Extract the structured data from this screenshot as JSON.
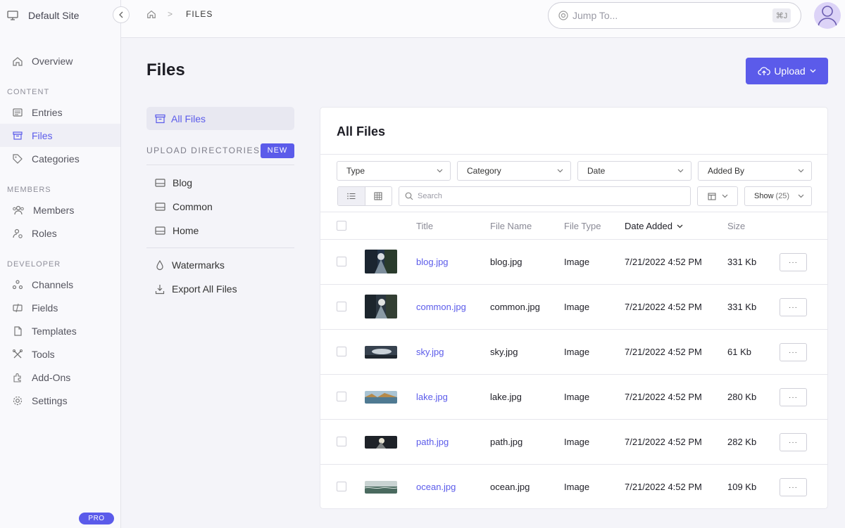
{
  "site": {
    "name": "Default Site"
  },
  "sidebar": {
    "overview": "Overview",
    "content_label": "CONTENT",
    "content": [
      {
        "label": "Entries",
        "icon": "entries-icon"
      },
      {
        "label": "Files",
        "icon": "files-icon",
        "active": true
      },
      {
        "label": "Categories",
        "icon": "tag-icon"
      }
    ],
    "members_label": "MEMBERS",
    "members": [
      {
        "label": "Members",
        "icon": "members-icon"
      },
      {
        "label": "Roles",
        "icon": "roles-icon"
      }
    ],
    "developer_label": "DEVELOPER",
    "developer": [
      {
        "label": "Channels",
        "icon": "channels-icon"
      },
      {
        "label": "Fields",
        "icon": "fields-icon"
      },
      {
        "label": "Templates",
        "icon": "templates-icon"
      },
      {
        "label": "Tools",
        "icon": "tools-icon"
      },
      {
        "label": "Add-Ons",
        "icon": "addons-icon"
      },
      {
        "label": "Settings",
        "icon": "gear-icon"
      }
    ],
    "pro_badge": "PRO"
  },
  "topbar": {
    "breadcrumb_sep": ">",
    "breadcrumb_current": "FILES",
    "jump_placeholder": "Jump To...",
    "jump_shortcut": "⌘J"
  },
  "page": {
    "title": "Files",
    "upload_label": "Upload"
  },
  "directories": {
    "all_files": "All Files",
    "upload_dirs_label": "UPLOAD DIRECTORIES",
    "new_label": "NEW",
    "items": [
      "Blog",
      "Common",
      "Home"
    ],
    "watermarks": "Watermarks",
    "export_all": "Export All Files"
  },
  "panel": {
    "title": "All Files",
    "filters": {
      "type": "Type",
      "category": "Category",
      "date": "Date",
      "added_by": "Added By"
    },
    "search_placeholder": "Search",
    "show_label": "Show",
    "show_count": "(25)",
    "columns": {
      "title": "Title",
      "file_name": "File Name",
      "file_type": "File Type",
      "date_added": "Date Added",
      "size": "Size"
    },
    "more_label": "···",
    "rows": [
      {
        "title": "blog.jpg",
        "file_name": "blog.jpg",
        "file_type": "Image",
        "date_added": "7/21/2022 4:52 PM",
        "size": "331 Kb",
        "thumb": "blog"
      },
      {
        "title": "common.jpg",
        "file_name": "common.jpg",
        "file_type": "Image",
        "date_added": "7/21/2022 4:52 PM",
        "size": "331 Kb",
        "thumb": "common"
      },
      {
        "title": "sky.jpg",
        "file_name": "sky.jpg",
        "file_type": "Image",
        "date_added": "7/21/2022 4:52 PM",
        "size": "61 Kb",
        "thumb": "sky"
      },
      {
        "title": "lake.jpg",
        "file_name": "lake.jpg",
        "file_type": "Image",
        "date_added": "7/21/2022 4:52 PM",
        "size": "280 Kb",
        "thumb": "lake"
      },
      {
        "title": "path.jpg",
        "file_name": "path.jpg",
        "file_type": "Image",
        "date_added": "7/21/2022 4:52 PM",
        "size": "282 Kb",
        "thumb": "path"
      },
      {
        "title": "ocean.jpg",
        "file_name": "ocean.jpg",
        "file_type": "Image",
        "date_added": "7/21/2022 4:52 PM",
        "size": "109 Kb",
        "thumb": "ocean"
      }
    ]
  },
  "colors": {
    "accent": "#5b5bea",
    "sidebar_bg": "#f9f9fc",
    "page_bg": "#f4f4f9"
  }
}
